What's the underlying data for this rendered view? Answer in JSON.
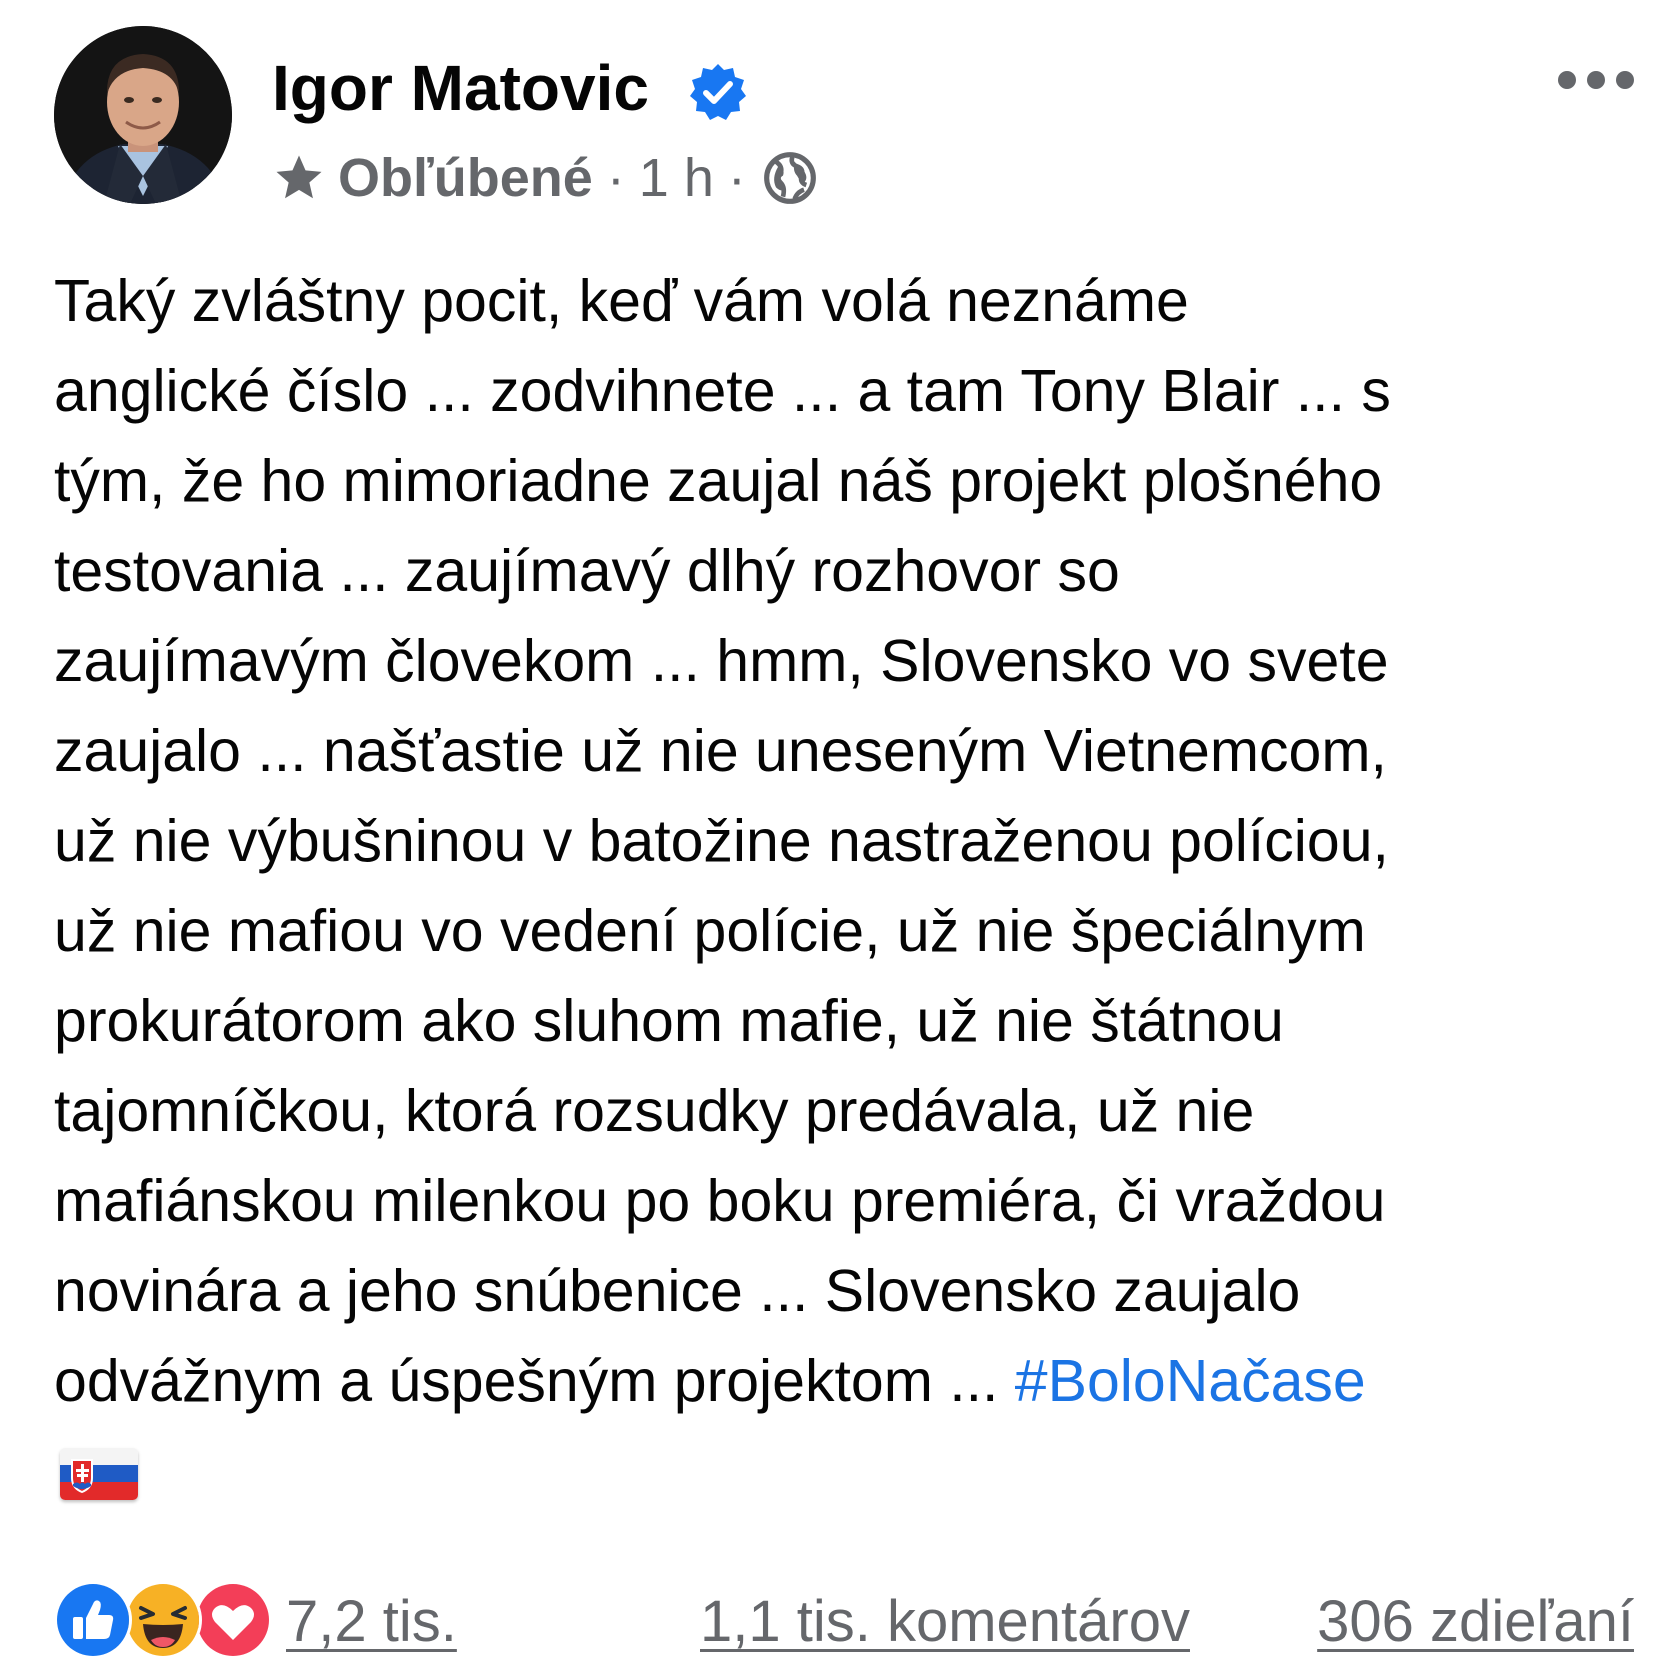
{
  "post": {
    "author_name": "Igor Matovic",
    "audience_label": "Obľúbené",
    "separator": "·",
    "time": "1 h",
    "body_lines": [
      "Taký zvláštny pocit, keď vám volá neznáme",
      "anglické číslo ... zodvihnete ... a tam Tony Blair ... s",
      "tým, že ho mimoriadne zaujal náš projekt plošného",
      "testovania ... zaujímavý dlhý rozhovor so",
      "zaujímavým človekom ... hmm, Slovensko vo svete",
      "zaujalo ... našťastie už nie uneseným Vietnemcom,",
      "už nie výbušninou v batožine nastraženou políciou,",
      "už nie mafiou vo vedení polície, už nie špeciálnym",
      "prokurátorom ako sluhom mafie, už nie štátnou",
      "tajomníčkou, ktorá rozsudky predávala, už nie",
      "mafiánskou milenkou po boku premiéra, či vraždou",
      "novinára a jeho snúbenice ... Slovensko zaujalo",
      "odvážnym a úspešným projektom ... "
    ],
    "hashtag": "#BoloNačase",
    "flag_icon": "slovakia-flag-emoji"
  },
  "footer": {
    "reactions": [
      "like-icon",
      "haha-icon",
      "love-icon"
    ],
    "reaction_count": "7,2 tis.",
    "comments": "1,1 tis. komentárov",
    "shares": "306 zdieľaní"
  },
  "colors": {
    "text": "#050505",
    "secondary": "#65676b",
    "link": "#1b74e4",
    "verified": "#1877f2",
    "like": "#1877f2",
    "love": "#f33e58",
    "haha": "#f7b125"
  }
}
